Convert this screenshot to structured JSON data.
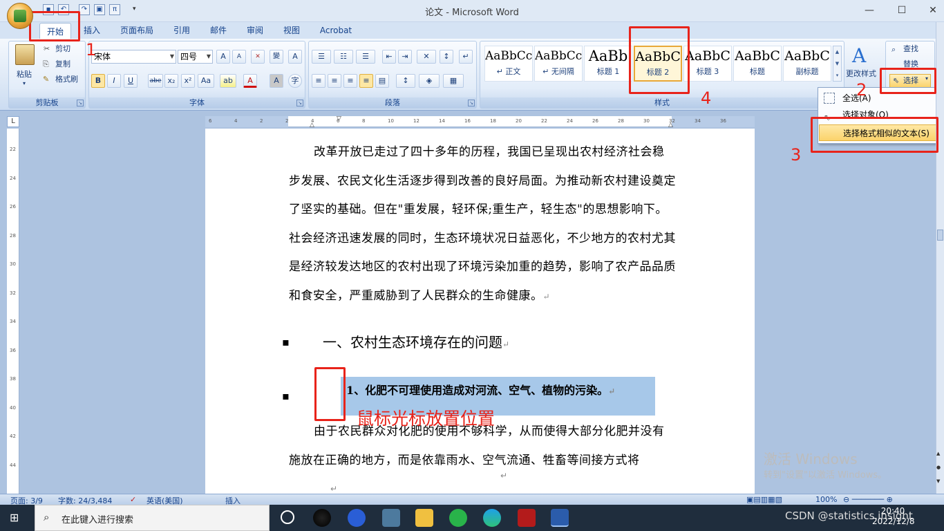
{
  "window": {
    "title": "论文 - Microsoft Word"
  },
  "tabs": [
    "开始",
    "插入",
    "页面布局",
    "引用",
    "邮件",
    "审阅",
    "视图",
    "Acrobat"
  ],
  "clipboard": {
    "paste": "粘贴",
    "cut": "剪切",
    "copy": "复制",
    "format_painter": "格式刷",
    "label": "剪贴板"
  },
  "font": {
    "name": "宋体",
    "size": "四号",
    "label": "字体",
    "size_up": "A",
    "size_down": "A",
    "clear": "A",
    "highlight": "ab",
    "color": "A",
    "bold": "B",
    "italic": "I",
    "underline": "U",
    "strike": "abe",
    "sub": "x₂",
    "sup": "x²",
    "case": "Aa"
  },
  "paragraph": {
    "label": "段落"
  },
  "styles": {
    "label": "样式",
    "items": [
      {
        "sample": "AaBbCcI",
        "name": "↵ 正文"
      },
      {
        "sample": "AaBbCcI",
        "name": "↵ 无间隔"
      },
      {
        "sample": "AaBb",
        "name": "标题 1"
      },
      {
        "sample": "AaBbC",
        "name": "标题 2"
      },
      {
        "sample": "AaBbC",
        "name": "标题 3"
      },
      {
        "sample": "AaBbC",
        "name": "标题"
      },
      {
        "sample": "AaBbC",
        "name": "副标题"
      }
    ],
    "change": "更改样式"
  },
  "editing": {
    "find": "查找",
    "replace": "替换",
    "select": "选择"
  },
  "select_menu": [
    "全选(A)",
    "选择对象(O)",
    "选择格式相似的文本(S)"
  ],
  "annotations": {
    "n1": "1",
    "n2": "2",
    "n3": "3",
    "n4": "4",
    "cursor_note": "鼠标光标放置位置"
  },
  "document": {
    "paragraph1": "改革开放已走过了四十多年的历程，我国已呈现出农村经济社会稳步发展、农民文化生活逐步得到改善的良好局面。为推动新农村建设奠定了坚实的基础。但在\"重发展，轻环保;重生产，轻生态\"的思想影响下。社会经济迅速发展的同时，生态环境状况日益恶化，不少地方的农村尤其是经济较发达地区的农村出现了环境污染加重的趋势，影响了农产品品质和食安全，严重威胁到了人民群众的生命健康。",
    "heading1": "一、农村生态环境存在的问题",
    "heading2": "1、化肥不可理使用造成对河流、空气、植物的污染。",
    "paragraph2": "由于农民群众对化肥的使用不够科学，从而使得大部分化肥并没有施放在正确的地方，而是依靠雨水、空气流通、牲畜等间接方式将"
  },
  "ruler_ticks": [
    "6",
    "4",
    "2",
    "2",
    "4",
    "6",
    "8",
    "10",
    "12",
    "14",
    "16",
    "18",
    "20",
    "22",
    "24",
    "26",
    "28",
    "30",
    "32",
    "34",
    "36"
  ],
  "vruler_ticks": [
    "22",
    "24",
    "26",
    "28",
    "30",
    "32",
    "34",
    "36",
    "38",
    "40",
    "42",
    "44"
  ],
  "status": {
    "page": "页面: 3/9",
    "words": "字数: 24/3,484",
    "lang": "英语(美国)",
    "mode": "插入",
    "zoom": "100%"
  },
  "activate": {
    "title": "激活 Windows",
    "sub": "转到\"设置\"以激活 Windows。"
  },
  "taskbar": {
    "search": "在此键入进行搜索",
    "time": "20:40",
    "date": "2022/12/8",
    "csdn": "CSDN @statistics.insight"
  }
}
